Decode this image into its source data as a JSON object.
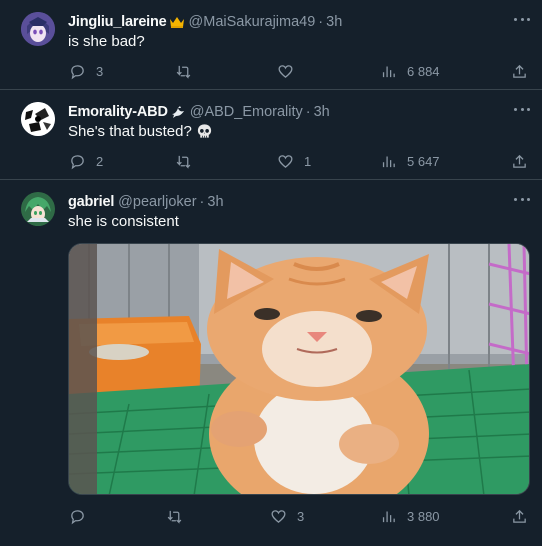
{
  "tweets": [
    {
      "name": "Jingliu_lareine",
      "badge_icon": "crown-icon",
      "handle": "@MaiSakurajima49",
      "separator": "·",
      "time": "3h",
      "text": "is she bad?",
      "replies": "3",
      "retweets": "",
      "likes": "",
      "views": "6 884"
    },
    {
      "name": "Emorality-ABD",
      "badge_icon": "dove-icon",
      "handle": "@ABD_Emorality",
      "separator": "·",
      "time": "3h",
      "text": "She's that busted?",
      "text_emoji_icon": "skull-icon",
      "replies": "2",
      "retweets": "",
      "likes": "1",
      "views": "5 647"
    },
    {
      "name": "gabriel",
      "handle": "@pearljoker",
      "separator": "·",
      "time": "3h",
      "text": "she is consistent",
      "media_icon": "kitten-photo",
      "replies": "",
      "retweets": "",
      "likes": "3",
      "views": "3 880"
    }
  ],
  "colors": {
    "background": "#15202b",
    "divider": "#38444d",
    "primary_text": "#f7f9f9",
    "secondary_text": "#8b98a5"
  }
}
